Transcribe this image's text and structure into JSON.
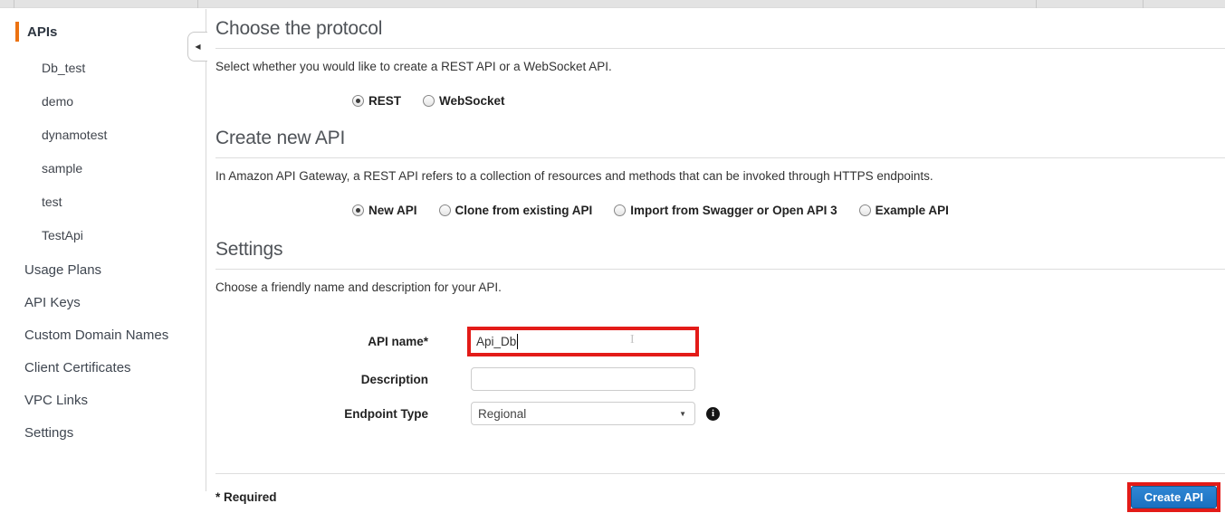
{
  "sidebar": {
    "section_label": "APIs",
    "api_items": [
      "Db_test",
      "demo",
      "dynamotest",
      "sample",
      "test",
      "TestApi"
    ],
    "nav_items": [
      "Usage Plans",
      "API Keys",
      "Custom Domain Names",
      "Client Certificates",
      "VPC Links",
      "Settings"
    ]
  },
  "sections": {
    "protocol": {
      "title": "Choose the protocol",
      "description": "Select whether you would like to create a REST API or a WebSocket API.",
      "options": [
        {
          "label": "REST",
          "selected": true
        },
        {
          "label": "WebSocket",
          "selected": false
        }
      ]
    },
    "create_api": {
      "title": "Create new API",
      "description": "In Amazon API Gateway, a REST API refers to a collection of resources and methods that can be invoked through HTTPS endpoints.",
      "options": [
        {
          "label": "New API",
          "selected": true
        },
        {
          "label": "Clone from existing API",
          "selected": false
        },
        {
          "label": "Import from Swagger or Open API 3",
          "selected": false
        },
        {
          "label": "Example API",
          "selected": false
        }
      ]
    },
    "settings": {
      "title": "Settings",
      "description": "Choose a friendly name and description for your API.",
      "fields": {
        "api_name": {
          "label": "API name*",
          "value": "Api_Db"
        },
        "description": {
          "label": "Description",
          "value": ""
        },
        "endpoint_type": {
          "label": "Endpoint Type",
          "value": "Regional"
        }
      }
    }
  },
  "footer": {
    "required_note": "* Required",
    "create_button": "Create API"
  },
  "icons": {
    "collapse_arrow": "◀",
    "select_arrow": "▼",
    "info": "i"
  },
  "colors": {
    "accent_orange": "#ec7211",
    "annotation_red": "#e31b18",
    "button_blue": "#1f76c8"
  }
}
